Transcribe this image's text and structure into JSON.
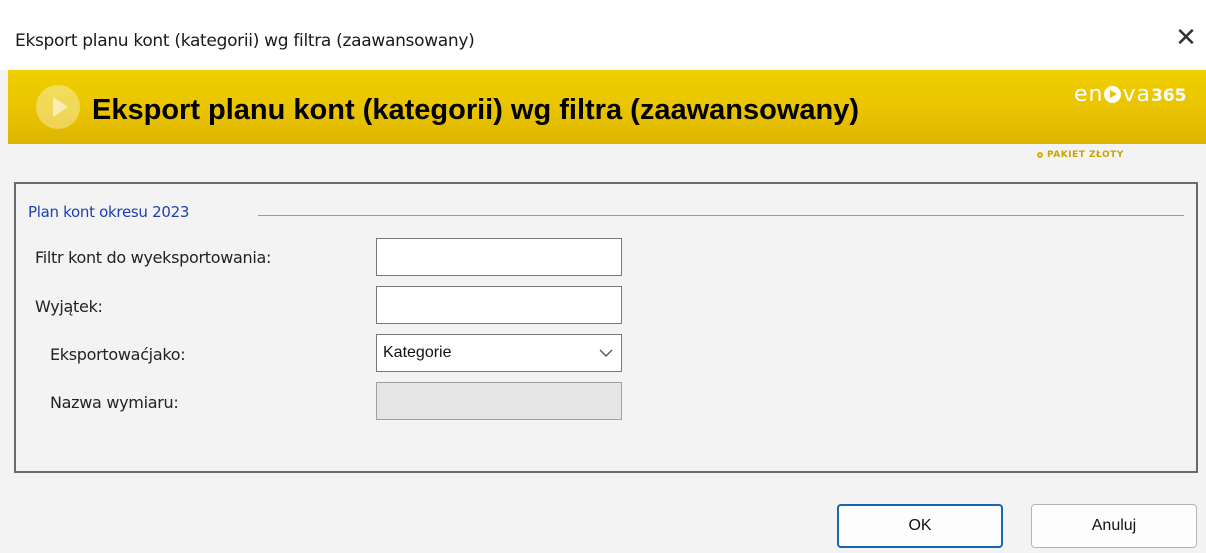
{
  "window": {
    "title": "Eksport planu kont (kategorii) wg filtra (zaawansowany)",
    "close_symbol": "✕"
  },
  "banner": {
    "heading": "Eksport planu kont (kategorii) wg filtra (zaawansowany)",
    "logo_prefix": "en",
    "logo_suffix": "va",
    "logo_number": "365",
    "package": "PAKIET ZŁOTY",
    "color": "#e8c200"
  },
  "group": {
    "title": "Plan kont okresu 2023"
  },
  "form": {
    "filter_label": "Filtr kont do wyeksportowania:",
    "filter_value": "",
    "exception_label": "Wyjątek:",
    "exception_value": "",
    "export_as_label": "Eksportowaćjako:",
    "export_as_value": "Kategorie",
    "dimension_label": "Nazwa wymiaru:",
    "dimension_value": ""
  },
  "buttons": {
    "ok": "OK",
    "cancel": "Anuluj"
  }
}
